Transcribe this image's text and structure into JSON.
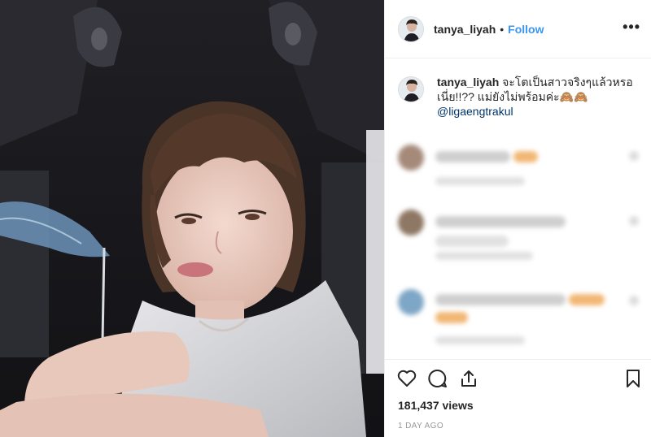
{
  "post": {
    "author": {
      "username": "tanya_liyah",
      "separator": "•",
      "follow_label": "Follow"
    },
    "more_options_label": "•••",
    "caption": {
      "username": "tanya_liyah",
      "text": "จะโตเป็นสาวจริงๆแล้วหรอเนี่ย!!?? แม่ยังไม่พร้อมค่ะ🙈🙈",
      "mention": "@ligaengtrakul"
    },
    "comments": [
      {
        "blurred": true
      },
      {
        "blurred": true
      },
      {
        "blurred": true
      },
      {
        "blurred": true
      }
    ],
    "actions": {
      "like_icon": "heart-icon",
      "comment_icon": "comment-icon",
      "share_icon": "share-icon",
      "save_icon": "bookmark-icon"
    },
    "views": "181,437 views",
    "timestamp": "1 DAY AGO"
  },
  "colors": {
    "follow": "#3897f0",
    "mention": "#003569",
    "meta_text": "#999999"
  }
}
